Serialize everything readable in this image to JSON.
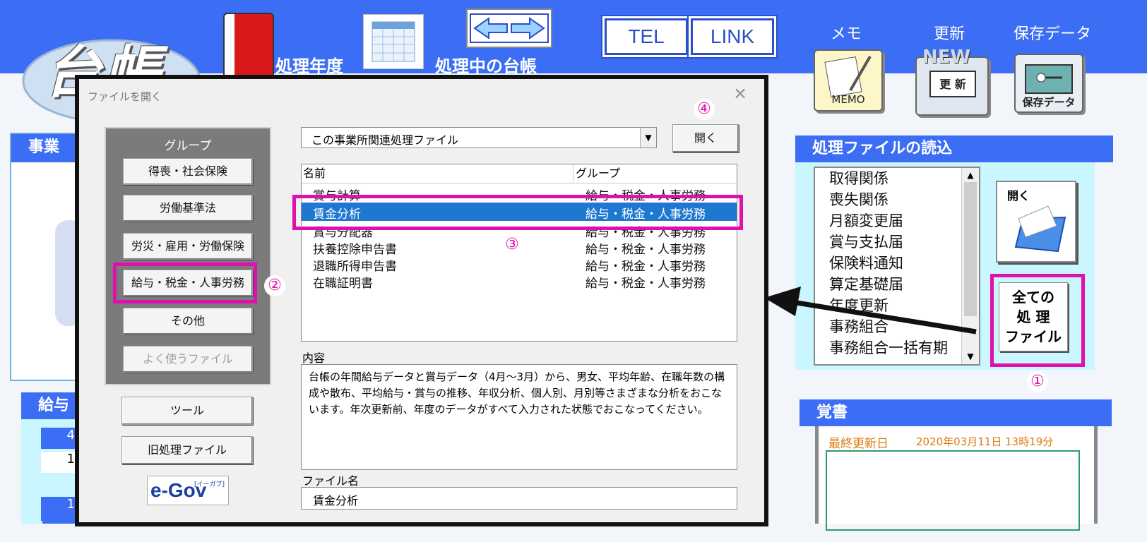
{
  "top": {
    "logo_text": "台帳",
    "year_label": "処理年度",
    "ledger_label": "処理中の台帳",
    "arrow_icon": "left-right-arrow",
    "tel_label": "TEL",
    "link_label": "LINK",
    "memo_label": "メモ",
    "memo_icon_text": "MEMO",
    "update_label": "更新",
    "update_icon_new": "NEW",
    "update_icon_text": "更 新",
    "save_label": "保存データ",
    "save_icon_text": "保存データ"
  },
  "left_bg": {
    "office_label": "事業",
    "salary_label": "給与",
    "cell_a": "4",
    "cell_b": "1",
    "cell_c": "1"
  },
  "right": {
    "load_header": "処理ファイルの読込",
    "list": [
      "取得関係",
      "喪失関係",
      "月額変更届",
      "賞与支払届",
      "保険料通知",
      "算定基礎届",
      "年度更新",
      "事務組合",
      "事務組合一括有期"
    ],
    "open_label": "開く",
    "all_files_label": [
      "全ての",
      "処 理",
      "ファイル"
    ],
    "memo_header": "覚書",
    "last_update_label": "最終更新日",
    "last_update_value": "2020年03月11日 13時19分"
  },
  "dialog": {
    "title": "ファイルを開く",
    "group_title": "グループ",
    "groups": [
      "得喪・社会保険",
      "労働基準法",
      "労災・雇用・労働保険",
      "給与・税金・人事労務",
      "その他",
      "よく使うファイル"
    ],
    "tool_label": "ツール",
    "old_files_label": "旧処理ファイル",
    "egov_label": "e-Gov",
    "egov_sub": "[イーガブ]",
    "category_select": "この事業所関連処理ファイル",
    "open_button": "開く",
    "col_name": "名前",
    "col_group": "グループ",
    "files": [
      {
        "name": "賞与計算",
        "group": "給与・税金・人事労務"
      },
      {
        "name": "賃金分析",
        "group": "給与・税金・人事労務"
      },
      {
        "name": "賞与分配器",
        "group": "給与・税金・人事労務"
      },
      {
        "name": "扶養控除申告書",
        "group": "給与・税金・人事労務"
      },
      {
        "name": "退職所得申告書",
        "group": "給与・税金・人事労務"
      },
      {
        "name": "在職証明書",
        "group": "給与・税金・人事労務"
      }
    ],
    "content_label": "内容",
    "content_text": "台帳の年間給与データと賞与データ（4月～3月）から、男女、平均年齢、在職年数の構成や散布、平均給与・賞与の推移、年収分析、個人別、月別等さまざまな分析をおこないます。年次更新前、年度のデータがすべて入力された状態でおこなってください。",
    "filename_label": "ファイル名",
    "filename_value": "賃金分析"
  },
  "markers": {
    "m1": "①",
    "m2": "②",
    "m3": "③",
    "m4": "④"
  },
  "colors": {
    "accent": "#3b6ef5",
    "highlight": "#e010b0",
    "selected": "#1f78d0"
  }
}
